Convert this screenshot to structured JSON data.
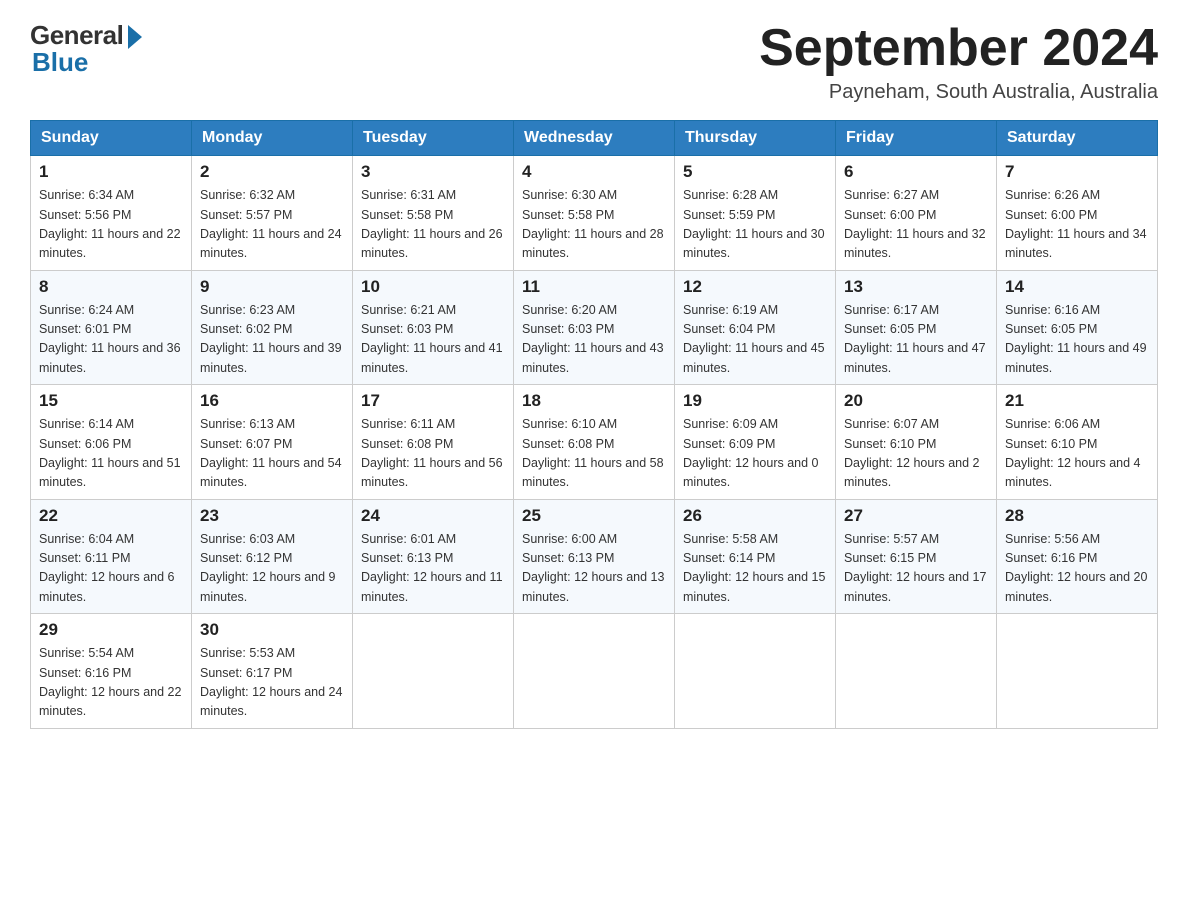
{
  "header": {
    "logo_general": "General",
    "logo_blue": "Blue",
    "month_title": "September 2024",
    "location": "Payneham, South Australia, Australia"
  },
  "days_of_week": [
    "Sunday",
    "Monday",
    "Tuesday",
    "Wednesday",
    "Thursday",
    "Friday",
    "Saturday"
  ],
  "weeks": [
    [
      {
        "day": "1",
        "sunrise": "6:34 AM",
        "sunset": "5:56 PM",
        "daylight": "11 hours and 22 minutes."
      },
      {
        "day": "2",
        "sunrise": "6:32 AM",
        "sunset": "5:57 PM",
        "daylight": "11 hours and 24 minutes."
      },
      {
        "day": "3",
        "sunrise": "6:31 AM",
        "sunset": "5:58 PM",
        "daylight": "11 hours and 26 minutes."
      },
      {
        "day": "4",
        "sunrise": "6:30 AM",
        "sunset": "5:58 PM",
        "daylight": "11 hours and 28 minutes."
      },
      {
        "day": "5",
        "sunrise": "6:28 AM",
        "sunset": "5:59 PM",
        "daylight": "11 hours and 30 minutes."
      },
      {
        "day": "6",
        "sunrise": "6:27 AM",
        "sunset": "6:00 PM",
        "daylight": "11 hours and 32 minutes."
      },
      {
        "day": "7",
        "sunrise": "6:26 AM",
        "sunset": "6:00 PM",
        "daylight": "11 hours and 34 minutes."
      }
    ],
    [
      {
        "day": "8",
        "sunrise": "6:24 AM",
        "sunset": "6:01 PM",
        "daylight": "11 hours and 36 minutes."
      },
      {
        "day": "9",
        "sunrise": "6:23 AM",
        "sunset": "6:02 PM",
        "daylight": "11 hours and 39 minutes."
      },
      {
        "day": "10",
        "sunrise": "6:21 AM",
        "sunset": "6:03 PM",
        "daylight": "11 hours and 41 minutes."
      },
      {
        "day": "11",
        "sunrise": "6:20 AM",
        "sunset": "6:03 PM",
        "daylight": "11 hours and 43 minutes."
      },
      {
        "day": "12",
        "sunrise": "6:19 AM",
        "sunset": "6:04 PM",
        "daylight": "11 hours and 45 minutes."
      },
      {
        "day": "13",
        "sunrise": "6:17 AM",
        "sunset": "6:05 PM",
        "daylight": "11 hours and 47 minutes."
      },
      {
        "day": "14",
        "sunrise": "6:16 AM",
        "sunset": "6:05 PM",
        "daylight": "11 hours and 49 minutes."
      }
    ],
    [
      {
        "day": "15",
        "sunrise": "6:14 AM",
        "sunset": "6:06 PM",
        "daylight": "11 hours and 51 minutes."
      },
      {
        "day": "16",
        "sunrise": "6:13 AM",
        "sunset": "6:07 PM",
        "daylight": "11 hours and 54 minutes."
      },
      {
        "day": "17",
        "sunrise": "6:11 AM",
        "sunset": "6:08 PM",
        "daylight": "11 hours and 56 minutes."
      },
      {
        "day": "18",
        "sunrise": "6:10 AM",
        "sunset": "6:08 PM",
        "daylight": "11 hours and 58 minutes."
      },
      {
        "day": "19",
        "sunrise": "6:09 AM",
        "sunset": "6:09 PM",
        "daylight": "12 hours and 0 minutes."
      },
      {
        "day": "20",
        "sunrise": "6:07 AM",
        "sunset": "6:10 PM",
        "daylight": "12 hours and 2 minutes."
      },
      {
        "day": "21",
        "sunrise": "6:06 AM",
        "sunset": "6:10 PM",
        "daylight": "12 hours and 4 minutes."
      }
    ],
    [
      {
        "day": "22",
        "sunrise": "6:04 AM",
        "sunset": "6:11 PM",
        "daylight": "12 hours and 6 minutes."
      },
      {
        "day": "23",
        "sunrise": "6:03 AM",
        "sunset": "6:12 PM",
        "daylight": "12 hours and 9 minutes."
      },
      {
        "day": "24",
        "sunrise": "6:01 AM",
        "sunset": "6:13 PM",
        "daylight": "12 hours and 11 minutes."
      },
      {
        "day": "25",
        "sunrise": "6:00 AM",
        "sunset": "6:13 PM",
        "daylight": "12 hours and 13 minutes."
      },
      {
        "day": "26",
        "sunrise": "5:58 AM",
        "sunset": "6:14 PM",
        "daylight": "12 hours and 15 minutes."
      },
      {
        "day": "27",
        "sunrise": "5:57 AM",
        "sunset": "6:15 PM",
        "daylight": "12 hours and 17 minutes."
      },
      {
        "day": "28",
        "sunrise": "5:56 AM",
        "sunset": "6:16 PM",
        "daylight": "12 hours and 20 minutes."
      }
    ],
    [
      {
        "day": "29",
        "sunrise": "5:54 AM",
        "sunset": "6:16 PM",
        "daylight": "12 hours and 22 minutes."
      },
      {
        "day": "30",
        "sunrise": "5:53 AM",
        "sunset": "6:17 PM",
        "daylight": "12 hours and 24 minutes."
      },
      null,
      null,
      null,
      null,
      null
    ]
  ]
}
